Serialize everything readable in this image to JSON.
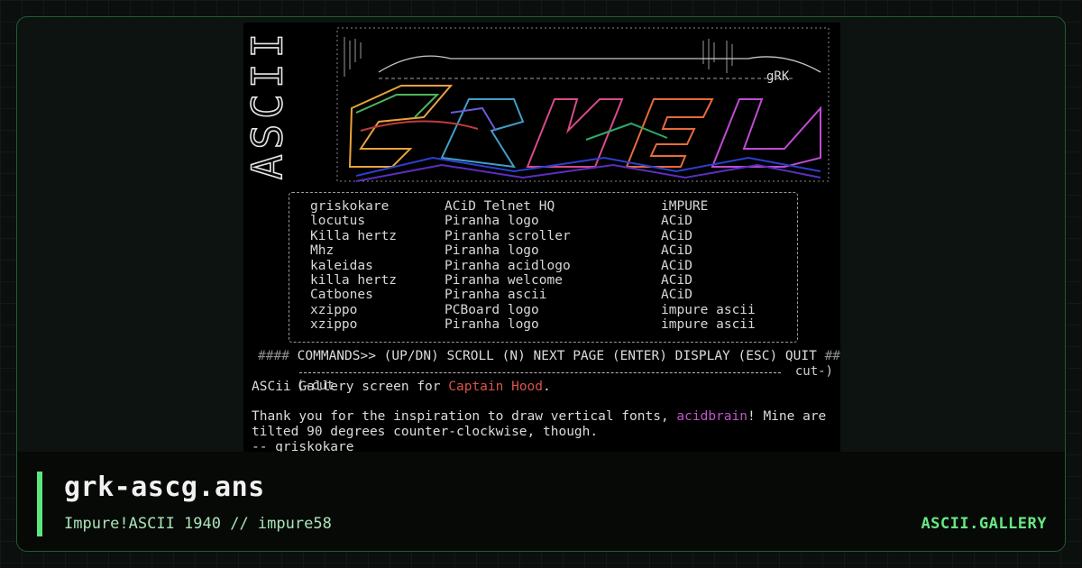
{
  "colors": {
    "accent": "#5ee57b",
    "background": "#0b100e",
    "terminal_bg": "#000000",
    "highlight_red": "#d9534a",
    "highlight_magenta": "#c255c9"
  },
  "art": {
    "side_text": "ASCII",
    "tag": "gRK"
  },
  "credits": [
    {
      "artist": "griskokare",
      "work": "ACiD Telnet HQ",
      "group": "iMPURE"
    },
    {
      "artist": "locutus",
      "work": "Piranha logo",
      "group": "ACiD"
    },
    {
      "artist": "Killa hertz",
      "work": "Piranha scroller",
      "group": "ACiD"
    },
    {
      "artist": "Mhz",
      "work": "Piranha logo",
      "group": "ACiD"
    },
    {
      "artist": "kaleidas",
      "work": "Piranha acidlogo",
      "group": "ACiD"
    },
    {
      "artist": "killa hertz",
      "work": "Piranha welcome",
      "group": "ACiD"
    },
    {
      "artist": "Catbones",
      "work": "Piranha ascii",
      "group": "ACiD"
    },
    {
      "artist": "xzippo",
      "work": "PCBoard logo",
      "group": "impure ascii"
    },
    {
      "artist": "xzippo",
      "work": "Piranha logo",
      "group": "impure ascii"
    }
  ],
  "commands": {
    "hash_left": "####",
    "text": "COMMANDS>> (UP/DN) SCROLL (N) NEXT PAGE (ENTER) DISPLAY (ESC) QUIT",
    "hash_right": "####"
  },
  "cut": {
    "left": "(-cut",
    "right": "cut-)"
  },
  "message": {
    "line1_prefix": "ASCii Gallery screen for ",
    "line1_name": "Captain Hood",
    "line1_suffix": ".",
    "line2_prefix": "Thank you for the inspiration to draw vertical fonts, ",
    "line2_name": "acidbrain",
    "line2_suffix": "! Mine are",
    "line3": "tilted 90 degrees counter-clockwise, though.",
    "line4": "-- griskokare"
  },
  "footer": {
    "title": "grk-ascg.ans",
    "subtitle": "Impure!ASCII 1940 // impure58",
    "brand": "ASCII.GALLERY"
  }
}
